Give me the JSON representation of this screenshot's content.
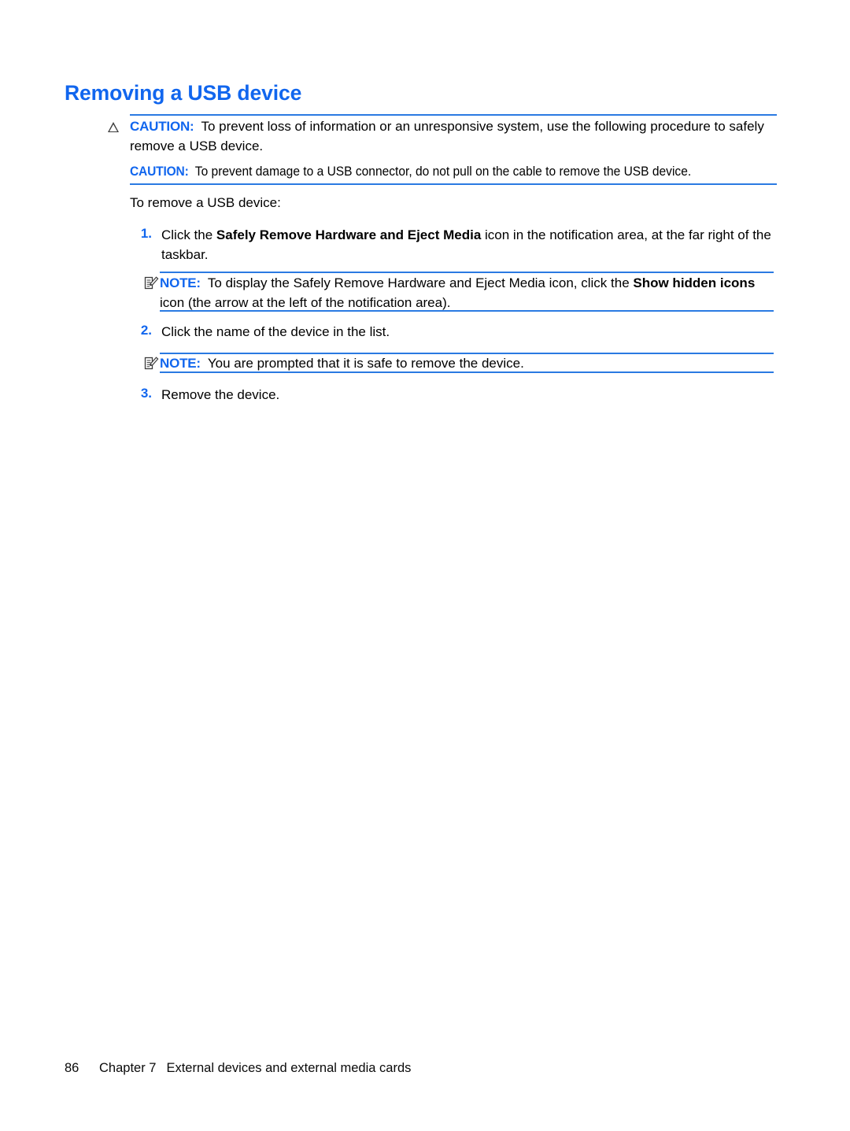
{
  "document": {
    "heading": "Removing a USB device",
    "intro_line": "To remove a USB device:",
    "accent_color": "#1166ee",
    "rule_color": "#2a7ae2"
  },
  "admonitions": {
    "caution_1": {
      "icon": "warning-triangle-icon",
      "keyword": "CAUTION:",
      "text": "To prevent loss of information or an unresponsive system, use the following procedure to safely remove a USB device."
    },
    "caution_2": {
      "keyword": "CAUTION:",
      "text": "To prevent damage to a USB connector, do not pull on the cable to remove the USB device."
    },
    "note_1": {
      "icon": "note-pencil-icon",
      "keyword": "NOTE:",
      "text_before_bold": "To display the Safely Remove Hardware and Eject Media icon, click the ",
      "bold_phrase": "Show hidden icons",
      "text_after_bold": " icon (the arrow at the left of the notification area)."
    },
    "note_2": {
      "icon": "note-pencil-icon",
      "keyword": "NOTE:",
      "text": "You are prompted that it is safe to remove the device."
    }
  },
  "steps": [
    {
      "number": "1.",
      "text_before_bold": "Click the ",
      "bold_phrase": "Safely Remove Hardware and Eject Media",
      "text_after_bold": " icon in the notification area, at the far right of the taskbar."
    },
    {
      "number": "2.",
      "text": "Click the name of the device in the list."
    },
    {
      "number": "3.",
      "text": "Remove the device."
    }
  ],
  "footer": {
    "page_number": "86",
    "chapter": "Chapter 7",
    "chapter_title": "External devices and external media cards"
  }
}
